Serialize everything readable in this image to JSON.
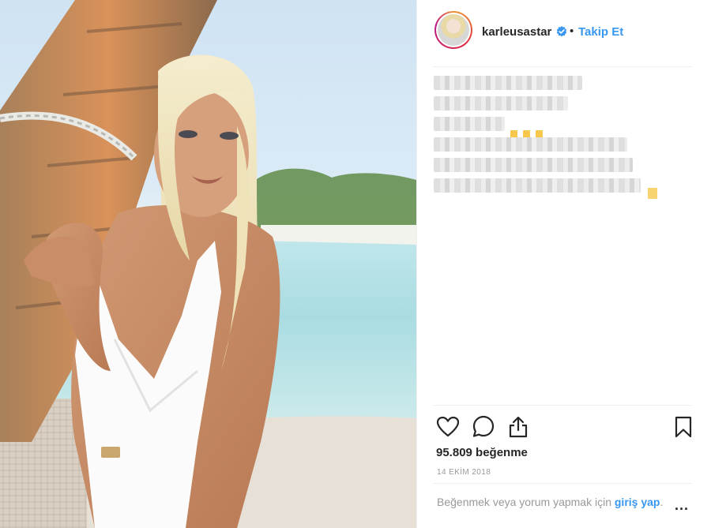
{
  "post": {
    "username": "karleusastar",
    "verified": true,
    "separator": "•",
    "follow_label": "Takip Et",
    "caption_blurred": true,
    "likes_text": "95.809 beğenme",
    "date_text": "14 EKİM 2018",
    "login_prompt_text": "Beğenmek veya yorum yapmak için ",
    "login_link_label": "giriş yap",
    "login_suffix": ".",
    "more_label": "..."
  },
  "icons": {
    "like": "heart-icon",
    "comment": "comment-icon",
    "share": "share-icon",
    "save": "bookmark-icon",
    "verified": "verified-badge-icon"
  },
  "colors": {
    "link": "#3897f0",
    "text": "#262626",
    "muted": "#999999",
    "divider": "#efefef"
  }
}
